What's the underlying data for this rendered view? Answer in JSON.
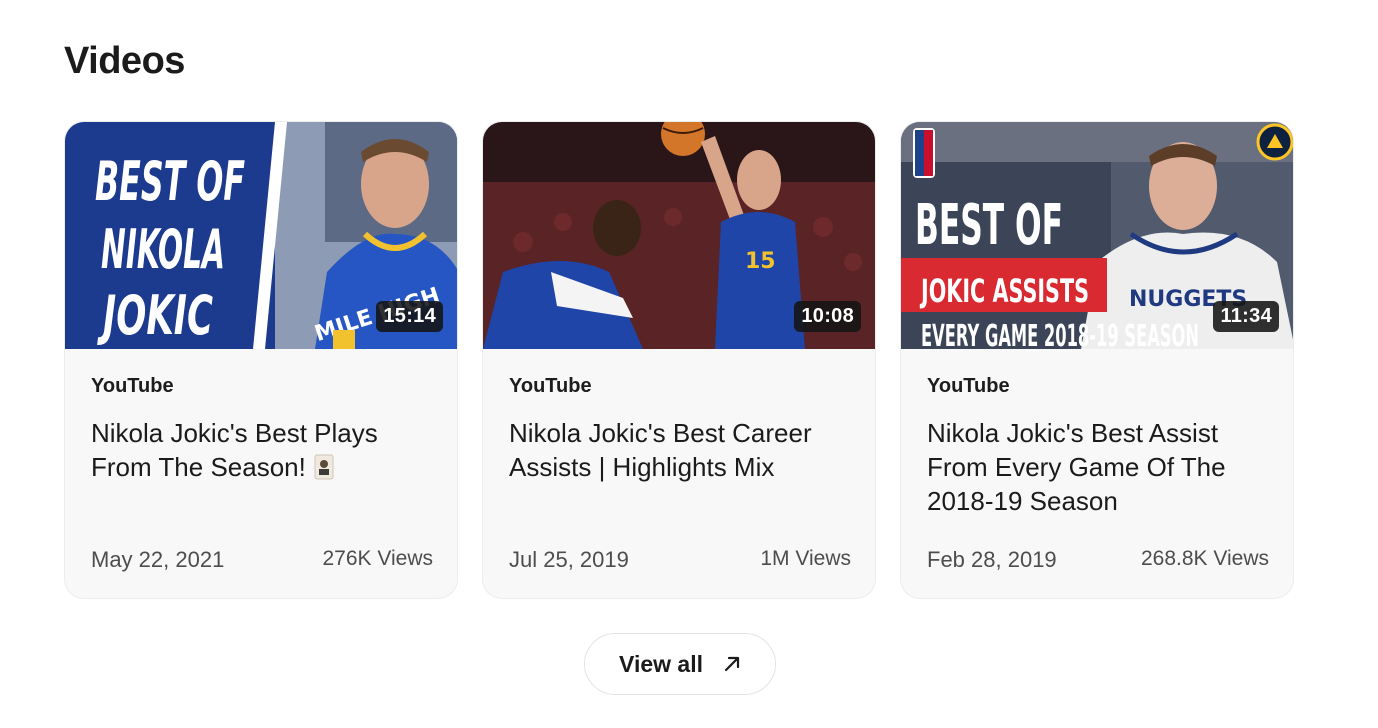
{
  "section": {
    "title": "Videos"
  },
  "videos": [
    {
      "source": "YouTube",
      "title": "Nikola Jokic's Best Plays From The Season!",
      "date": "May 22, 2021",
      "views": "276K Views",
      "duration": "15:14",
      "thumbnail_text": [
        "BEST OF",
        "NIKOLA",
        "JOKIC"
      ],
      "jersey_text": "MILE HIGH"
    },
    {
      "source": "YouTube",
      "title": "Nikola Jokic's Best Career Assists | Highlights Mix",
      "date": "Jul 25, 2019",
      "views": "1M Views",
      "duration": "10:08",
      "jersey_text": "15"
    },
    {
      "source": "YouTube",
      "title": "Nikola Jokic's Best Assist From Every Game Of The 2018-19 Season",
      "date": "Feb 28, 2019",
      "views": "268.8K Views",
      "duration": "11:34",
      "thumbnail_text": [
        "BEST OF",
        "JOKIC ASSISTS",
        "EVERY GAME 2018-19 SEASON"
      ],
      "jersey_text": "NUGGETS"
    }
  ],
  "footer": {
    "view_all_label": "View all"
  },
  "colors": {
    "nuggets_blue": "#1f45a8",
    "nuggets_gold": "#f2c12e",
    "banner_red": "#d92a32",
    "card_bg": "#f8f8f8"
  }
}
